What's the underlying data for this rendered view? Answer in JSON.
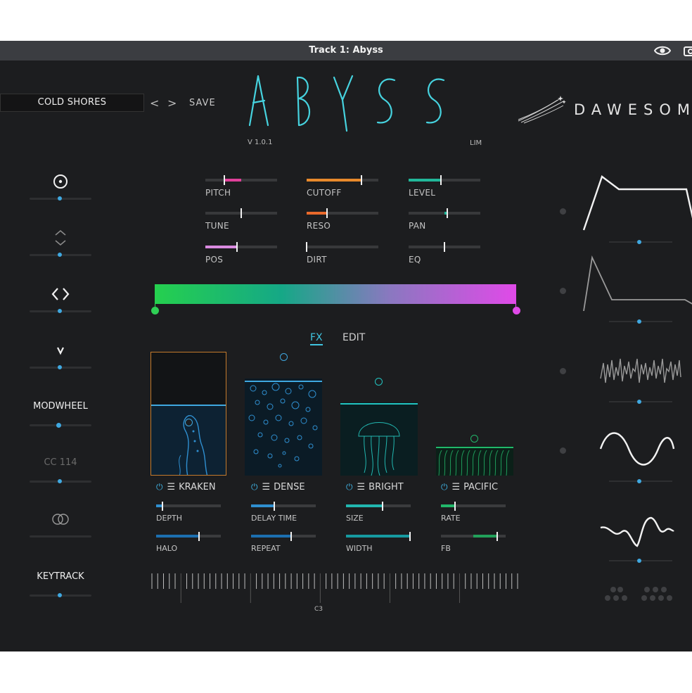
{
  "window": {
    "title": "Track 1: Abyss"
  },
  "header": {
    "preset_name": "COLD SHORES",
    "prev_label": "<",
    "next_label": ">",
    "save_label": "SAVE",
    "logo_text": "ABYSS",
    "version": "V 1.0.1",
    "lim": "LIM",
    "brand": "DAWESOM"
  },
  "colors": {
    "background": "#1c1d1f",
    "titlebar": "#3b3d41",
    "accent": "#3fa8e0",
    "logo": "#46d3df",
    "pitch": "#e0409a",
    "cutoff": "#e8892b",
    "level": "#22b79a",
    "reso": "#e8692b",
    "pos": "#d98ae0"
  },
  "left_mod": [
    {
      "icon": "circle-dot-icon",
      "label": "",
      "level": 0.49
    },
    {
      "icon": "chevron-up-down-icon",
      "label": "",
      "level": 0.49
    },
    {
      "icon": "angle-brackets-icon",
      "label": "",
      "level": 0.49
    },
    {
      "icon": "chevron-down-icon",
      "label": "",
      "level": 0.49
    },
    {
      "icon": "",
      "label": "MODWHEEL",
      "level": 0.47
    },
    {
      "icon": "",
      "label": "CC 114",
      "level": 0.49
    },
    {
      "icon": "rings-icon",
      "label": "",
      "level": 0.49
    },
    {
      "icon": "",
      "label": "KEYTRACK",
      "level": 0.49
    }
  ],
  "params": [
    {
      "label": "PITCH",
      "value": 0.26,
      "fill_from": 0.26,
      "fill_to": 0.5,
      "color": "#e0409a"
    },
    {
      "label": "CUTOFF",
      "value": 0.76,
      "fill_from": 0.0,
      "fill_to": 0.76,
      "color": "#e8892b"
    },
    {
      "label": "LEVEL",
      "value": 0.45,
      "fill_from": 0.0,
      "fill_to": 0.45,
      "color": "#22b79a"
    },
    {
      "label": "TUNE",
      "value": 0.5,
      "fill_from": 0.0,
      "fill_to": 0.0,
      "color": "#9a9a9a"
    },
    {
      "label": "RESO",
      "value": 0.28,
      "fill_from": 0.0,
      "fill_to": 0.28,
      "color": "#e8692b"
    },
    {
      "label": "PAN",
      "value": 0.54,
      "fill_from": 0.5,
      "fill_to": 0.54,
      "color": "#22b79a"
    },
    {
      "label": "POS",
      "value": 0.44,
      "fill_from": 0.0,
      "fill_to": 0.44,
      "color": "#d98ae0"
    },
    {
      "label": "DIRT",
      "value": 0.0,
      "fill_from": 0.0,
      "fill_to": 0.0,
      "color": "#9a9a9a"
    },
    {
      "label": "EQ",
      "value": 0.5,
      "fill_from": 0.0,
      "fill_to": 0.0,
      "color": "#9a9a9a"
    }
  ],
  "tabs": {
    "fx": "FX",
    "edit": "EDIT"
  },
  "fx_slots": [
    {
      "name": "KRAKEN",
      "power": "⏻",
      "menu": "☰",
      "level": 0.43
    },
    {
      "name": "DENSE",
      "power": "⏻",
      "menu": "☰",
      "level": 0.96
    },
    {
      "name": "BRIGHT",
      "power": "⏻",
      "menu": "☰",
      "level": 0.76
    },
    {
      "name": "PACIFIC",
      "power": "⏻",
      "menu": "☰",
      "level": 0.3
    }
  ],
  "fx_params": [
    {
      "label": "DEPTH",
      "value": 0.1,
      "fill_from": 0.0,
      "fill_to": 0.1,
      "color": "#2f8fd0"
    },
    {
      "label": "DELAY TIME",
      "value": 0.36,
      "fill_from": 0.0,
      "fill_to": 0.36,
      "color": "#2f8fd0"
    },
    {
      "label": "SIZE",
      "value": 0.56,
      "fill_from": 0.0,
      "fill_to": 0.56,
      "color": "#22b7b0"
    },
    {
      "label": "RATE",
      "value": 0.22,
      "fill_from": 0.0,
      "fill_to": 0.22,
      "color": "#22b76a"
    },
    {
      "label": "HALO",
      "value": 0.66,
      "fill_from": 0.0,
      "fill_to": 0.66,
      "color": "#1c6fb0"
    },
    {
      "label": "REPEAT",
      "value": 0.62,
      "fill_from": 0.0,
      "fill_to": 0.62,
      "color": "#1c6fb0"
    },
    {
      "label": "WIDTH",
      "value": 0.99,
      "fill_from": 0.0,
      "fill_to": 0.99,
      "color": "#169aa0"
    },
    {
      "label": "FB",
      "value": 0.87,
      "fill_from": 0.5,
      "fill_to": 0.87,
      "color": "#22a05a"
    }
  ],
  "keyboard": {
    "label": "C3"
  },
  "right_mod": [
    {
      "icon": "envelope-1-icon",
      "level": 0.49
    },
    {
      "icon": "envelope-2-icon",
      "level": 0.49
    },
    {
      "icon": "random-noise-icon",
      "level": 0.49
    },
    {
      "icon": "sine-lfo-icon",
      "level": 0.49
    },
    {
      "icon": "curve-lfo-icon",
      "level": 0.49
    },
    {
      "icon": "dots-pattern-icon",
      "level": 0.49
    }
  ]
}
